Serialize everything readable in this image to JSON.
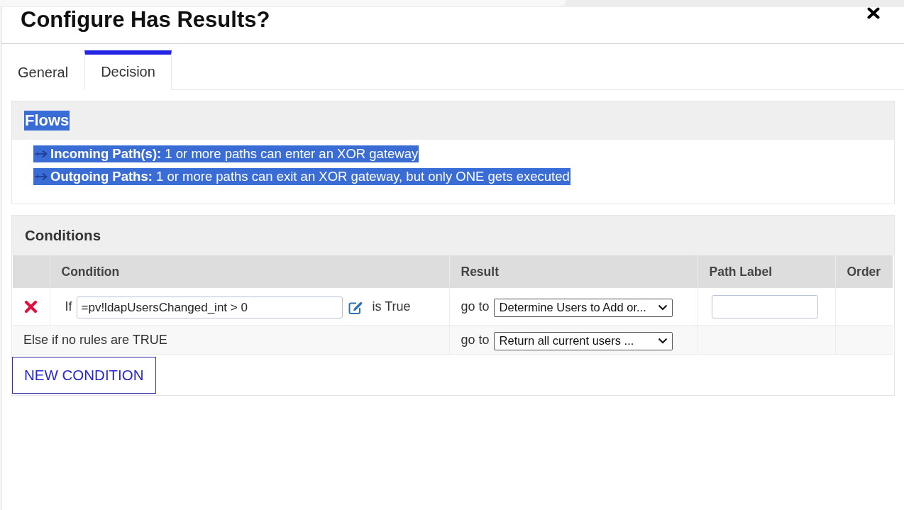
{
  "dialog": {
    "title": "Configure Has Results?"
  },
  "tabs": [
    {
      "label": "General",
      "selected": false
    },
    {
      "label": "Decision",
      "selected": true
    }
  ],
  "flows": {
    "title": "Flows",
    "title_highlighted": true,
    "items": [
      {
        "text": "**Incoming Path(s):** 1 or more paths can enter an XOR gateway",
        "highlighted": true
      },
      {
        "text": "**Outgoing Paths:** 1 or more paths can exit an XOR gateway, but only ONE gets executed",
        "highlighted": true
      }
    ]
  },
  "conditions": {
    "title": "Conditions",
    "table": {
      "columns": [
        "Condition",
        "Result",
        "Path Label",
        "Order"
      ],
      "rows": [
        {
          "kind": "rule",
          "prefix": "If",
          "condition": "=pv!ldapUsersChanged_int > 0",
          "suffix": "is True",
          "result_prefix": "go to",
          "result": "Determine Users to Add or..."
        },
        {
          "kind": "else",
          "label": "Else if no rules are TRUE",
          "result_prefix": "go to",
          "result": "Return all current users ..."
        }
      ]
    },
    "new_button": "NEW CONDITION"
  }
}
